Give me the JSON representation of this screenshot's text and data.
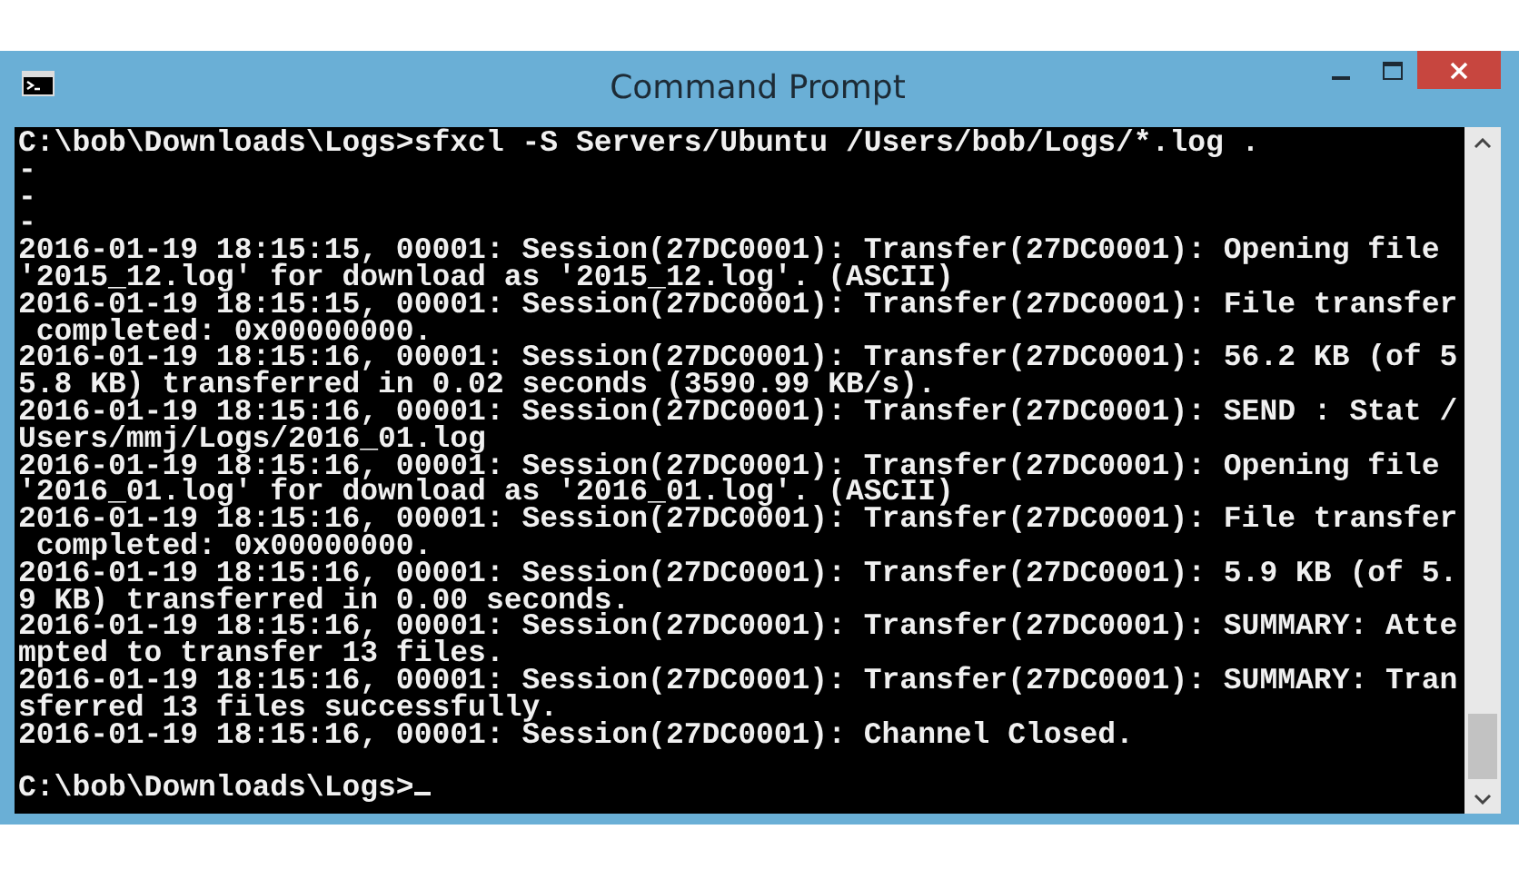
{
  "window": {
    "title": "Command Prompt"
  },
  "console": {
    "lines": [
      "C:\\bob\\Downloads\\Logs>sfxcl -S Servers/Ubuntu /Users/bob/Logs/*.log .",
      "-",
      "-",
      "-",
      "2016-01-19 18:15:15, 00001: Session(27DC0001): Transfer(27DC0001): Opening file",
      "'2015_12.log' for download as '2015_12.log'. (ASCII)",
      "2016-01-19 18:15:15, 00001: Session(27DC0001): Transfer(27DC0001): File transfer",
      " completed: 0x00000000.",
      "2016-01-19 18:15:16, 00001: Session(27DC0001): Transfer(27DC0001): 56.2 KB (of 5",
      "5.8 KB) transferred in 0.02 seconds (3590.99 KB/s).",
      "2016-01-19 18:15:16, 00001: Session(27DC0001): Transfer(27DC0001): SEND : Stat /",
      "Users/mmj/Logs/2016_01.log",
      "2016-01-19 18:15:16, 00001: Session(27DC0001): Transfer(27DC0001): Opening file",
      "'2016_01.log' for download as '2016_01.log'. (ASCII)",
      "2016-01-19 18:15:16, 00001: Session(27DC0001): Transfer(27DC0001): File transfer",
      " completed: 0x00000000.",
      "2016-01-19 18:15:16, 00001: Session(27DC0001): Transfer(27DC0001): 5.9 KB (of 5.",
      "9 KB) transferred in 0.00 seconds.",
      "2016-01-19 18:15:16, 00001: Session(27DC0001): Transfer(27DC0001): SUMMARY: Atte",
      "mpted to transfer 13 files.",
      "2016-01-19 18:15:16, 00001: Session(27DC0001): Transfer(27DC0001): SUMMARY: Tran",
      "sferred 13 files successfully.",
      "2016-01-19 18:15:16, 00001: Session(27DC0001): Channel Closed."
    ],
    "prompt": "C:\\bob\\Downloads\\Logs>"
  }
}
